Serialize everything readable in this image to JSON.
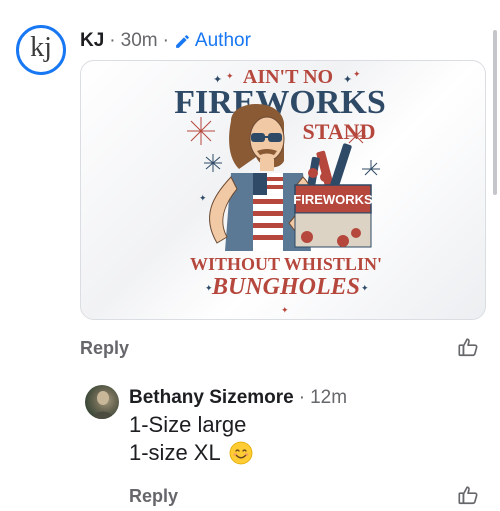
{
  "comment": {
    "avatar_text": "kj",
    "author": "KJ",
    "separator": "·",
    "time": "30m",
    "badge_label": "Author",
    "reply_label": "Reply",
    "image": {
      "line1": "AIN'T NO",
      "line2": "FIREWORKS",
      "line3": "STAND",
      "sign": "FIREWORKS",
      "line4": "WITHOUT WHISTLIN'",
      "line5": "BUNGHOLES"
    }
  },
  "reply": {
    "author": "Bethany Sizemore",
    "separator": "·",
    "time": "12m",
    "line1": "1-Size large",
    "line2": "1-size XL",
    "emoji": "smiling-face-icon",
    "reply_label": "Reply"
  },
  "colors": {
    "accent": "#1877f2",
    "secondary_text": "#65676b",
    "navy": "#2e4a66",
    "red": "#b5473d"
  }
}
